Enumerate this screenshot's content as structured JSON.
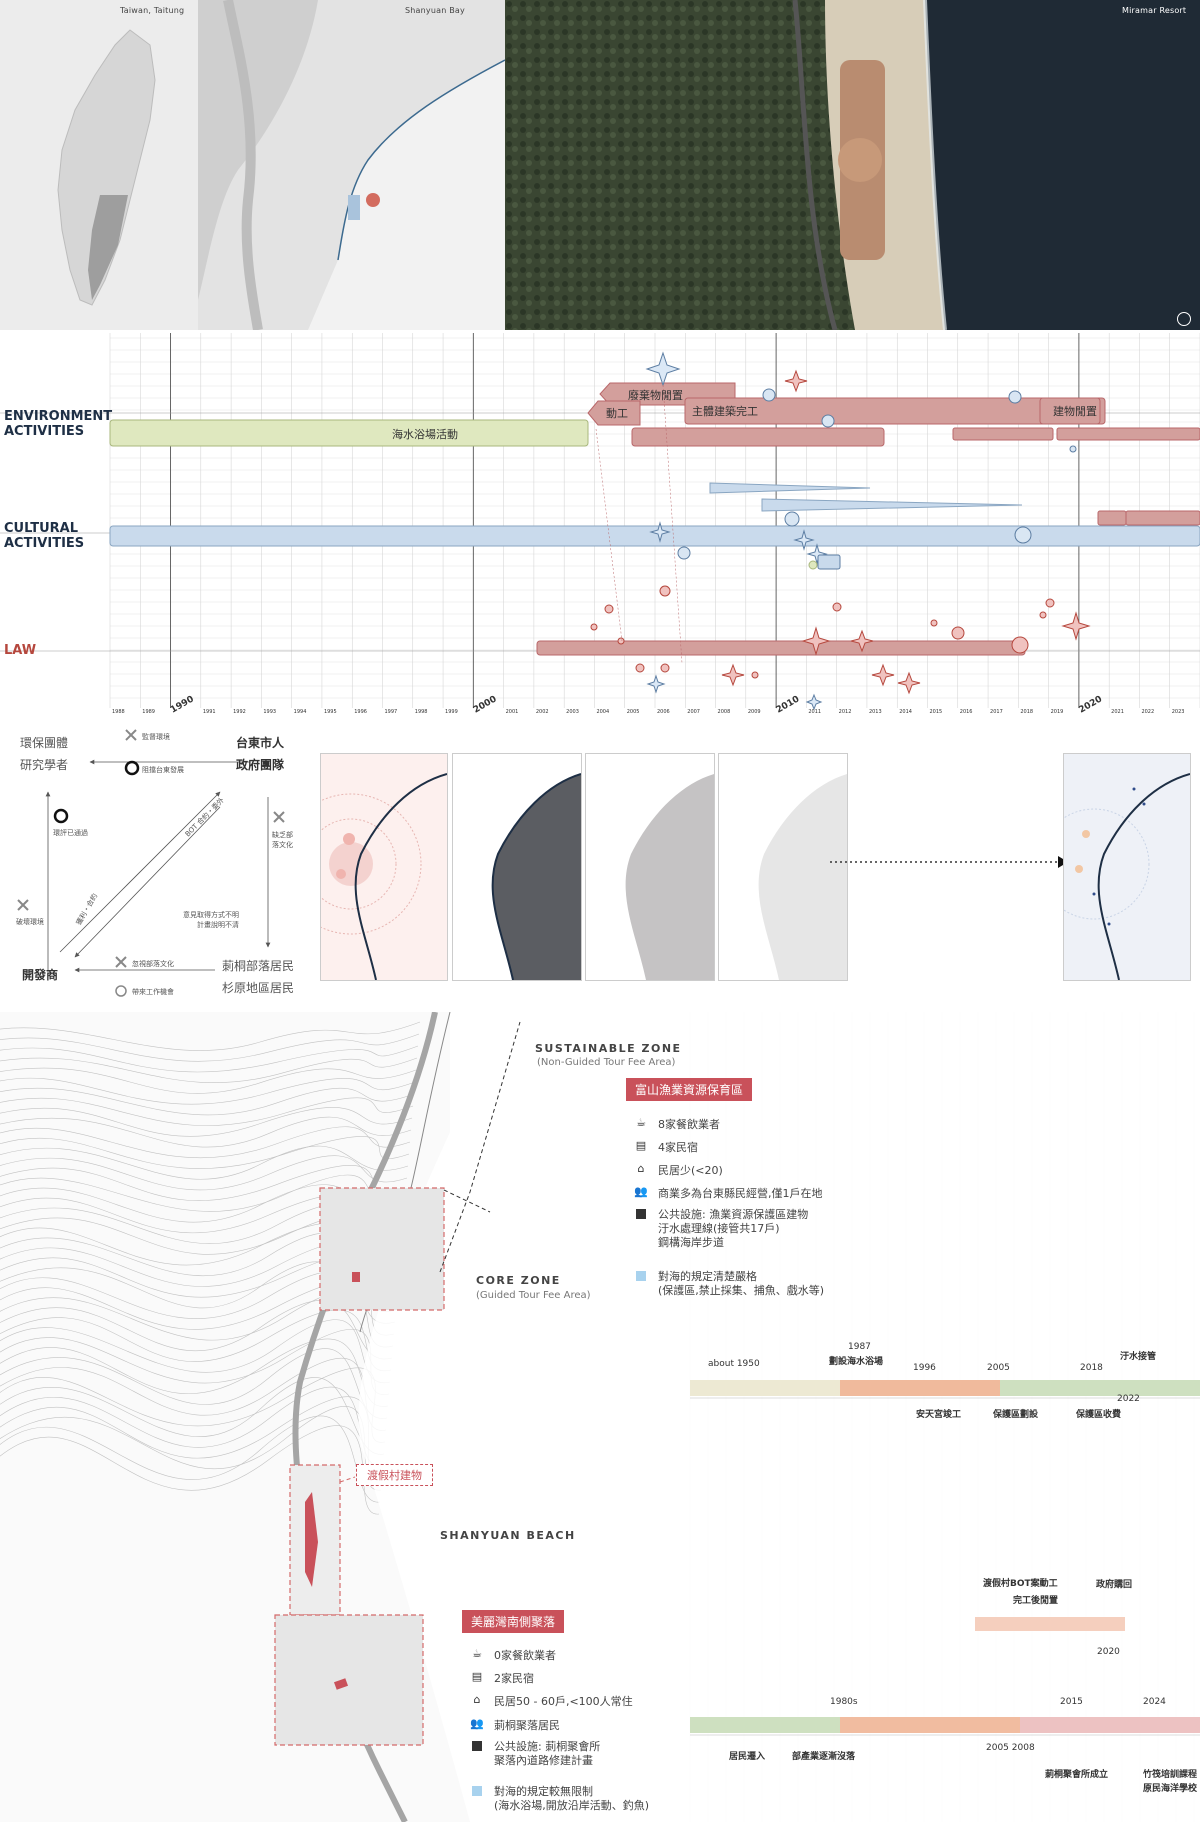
{
  "maps": {
    "panels": [
      {
        "label": "Taiwan, Taitung"
      },
      {
        "label": "Shanyuan Bay"
      },
      {
        "label": "Miramar Resort"
      }
    ]
  },
  "timeline": {
    "rows": [
      {
        "label": "ENVIRONMENT\nACTIVITIES"
      },
      {
        "label": "CULTURAL\nACTIVITIES"
      },
      {
        "label": "LAW"
      }
    ],
    "environment_bars": [
      {
        "text": "海水浴場活動"
      },
      {
        "text": "廢棄物閒置"
      },
      {
        "text": "動工"
      },
      {
        "text": "主體建築完工"
      },
      {
        "text": "建物閒置"
      }
    ],
    "years": [
      {
        "label": "1988"
      },
      {
        "label": "1989"
      },
      {
        "label": "1990"
      },
      {
        "label": "1991"
      },
      {
        "label": "1992"
      },
      {
        "label": "1993"
      },
      {
        "label": "1994"
      },
      {
        "label": "1995"
      },
      {
        "label": "1996"
      },
      {
        "label": "1997"
      },
      {
        "label": "1998"
      },
      {
        "label": "1999"
      },
      {
        "label": "2000"
      },
      {
        "label": "2001"
      },
      {
        "label": "2002"
      },
      {
        "label": "2003"
      },
      {
        "label": "2004"
      },
      {
        "label": "2005"
      },
      {
        "label": "2006"
      },
      {
        "label": "2007"
      },
      {
        "label": "2008"
      },
      {
        "label": "2009"
      },
      {
        "label": "2010"
      },
      {
        "label": "2011"
      },
      {
        "label": "2012"
      },
      {
        "label": "2013"
      },
      {
        "label": "2014"
      },
      {
        "label": "2015"
      },
      {
        "label": "2016"
      },
      {
        "label": "2017"
      },
      {
        "label": "2018"
      },
      {
        "label": "2019"
      },
      {
        "label": "2020"
      },
      {
        "label": "2021"
      },
      {
        "label": "2022"
      },
      {
        "label": "2023"
      },
      {
        "label": "2024"
      }
    ]
  },
  "relations": {
    "actors": {
      "env_group": "環保團體",
      "researchers": "研究學者",
      "taitung_citizens": "台東市人",
      "government": "政府團隊",
      "developer": "開發商",
      "fugang": "莿桐部落居民",
      "shanyuan": "杉原地區居民"
    },
    "relations": {
      "r1": "監督環境",
      "r2": "阻擋台東發展",
      "r3": "環評已通過",
      "r4": "BOT 合約・委外",
      "r5": "破壞環境",
      "r6": "缺乏部落文化",
      "r7": "意見取得方式不明\n計畫說明不清",
      "r8": "獲利・合約",
      "r9": "忽視部落文化",
      "r10": "帶來工作機會"
    }
  },
  "bottom": {
    "sustainable_zone": {
      "title": "SUSTAINABLE ZONE",
      "sub": "(Non-Guided Tour Fee Area)"
    },
    "core_zone": {
      "title": "CORE ZONE",
      "sub": "(Guided Tour Fee Area)"
    },
    "beach": "SHANYUAN BEACH",
    "resort_tag": "渡假村建物",
    "upper": {
      "tag": "富山漁業資源保育區",
      "items": [
        {
          "icon": "coffee-icon",
          "text": "8家餐飲業者"
        },
        {
          "icon": "bed-icon",
          "text": "4家民宿"
        },
        {
          "icon": "house-icon",
          "text": "民居少(<20)"
        },
        {
          "icon": "people-icon",
          "text": "商業多為台東縣民經營,僅1戶在地"
        },
        {
          "icon": "square-icon",
          "text": "公共設施: 漁業資源保護區建物\n汙水處理線(接管共17戶)\n鋼構海岸步道"
        },
        {
          "icon": "blue-square-icon",
          "text": "對海的規定清楚嚴格\n(保護區,禁止採集、捕魚、戲水等)"
        }
      ]
    },
    "lower": {
      "tag": "美麗灣南側聚落",
      "items": [
        {
          "icon": "coffee-icon",
          "text": "0家餐飲業者"
        },
        {
          "icon": "bed-icon",
          "text": "2家民宿"
        },
        {
          "icon": "house-icon",
          "text": "民居50 - 60戶,<100人常住"
        },
        {
          "icon": "people-icon",
          "text": "莿桐聚落居民"
        },
        {
          "icon": "square-icon",
          "text": "公共設施: 莿桐聚會所\n聚落內道路修建計畫"
        },
        {
          "icon": "blue-square-icon",
          "text": "對海的規定較無限制\n(海水浴場,開放沿岸活動、釣魚)"
        }
      ]
    },
    "upper_timeline": {
      "years": [
        "about 1950",
        "1987",
        "1996",
        "2005",
        "2018",
        "2022"
      ],
      "events": [
        "劃設海水浴場",
        "安天宮竣工",
        "保護區劃設",
        "保護區收費",
        "汙水接管"
      ]
    },
    "lower_timeline": {
      "years": [
        "1980s",
        "2005 2008",
        "2015",
        "2020",
        "2024"
      ],
      "events": [
        "渡假村BOT案動工",
        "完工後閒置",
        "政府購回",
        "居民遷入",
        "部產業逐漸沒落",
        "莿桐聚會所成立",
        "竹筏培訓課程",
        "原民海洋學校"
      ]
    }
  },
  "colors": {
    "env_green": "#dfe8bf",
    "env_red": "#d39f9c",
    "cultural_blue": "#c9daec",
    "law_red": "#d39f9c",
    "tag_red": "#c9515a"
  }
}
